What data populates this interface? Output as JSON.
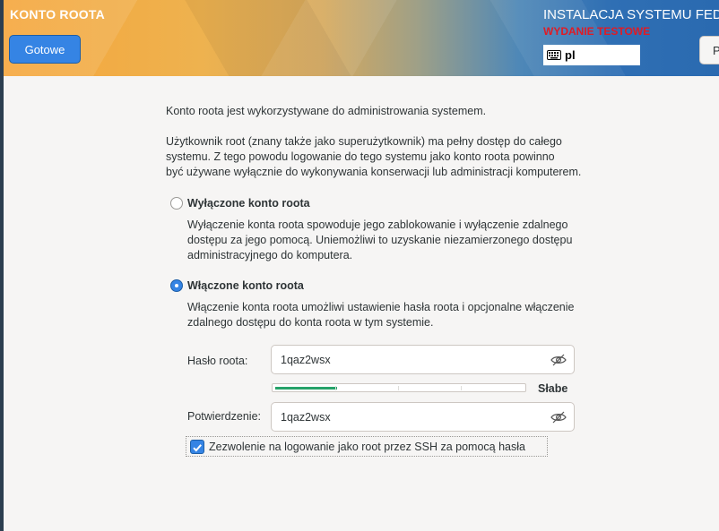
{
  "header": {
    "spoke_title": "KONTO ROOTA",
    "done_label": "Gotowe",
    "product_title": "INSTALACJA SYSTEMU FEDORA",
    "beta_warning": "WYDANIE TESTOWE",
    "keyboard_layout": "pl",
    "help_label": "P"
  },
  "content": {
    "intro": "Konto roota jest wykorzystywane do administrowania systemem.",
    "description_lines": [
      "Użytkownik root (znany także jako superużytkownik) ma pełny dostęp do całego",
      "systemu. Z tego powodu logowanie do tego systemu jako konto roota powinno",
      "być używane wyłącznie do wykonywania konserwacji lub administracji komputerem."
    ],
    "options": {
      "disable": {
        "label": "Wyłączone konto roota",
        "selected": false,
        "description_lines": [
          "Wyłączenie konta roota spowoduje jego zablokowanie i wyłączenie zdalnego",
          "dostępu za jego pomocą. Uniemożliwi to uzyskanie niezamierzonego dostępu",
          "administracyjnego do komputera."
        ]
      },
      "enable": {
        "label": "Włączone konto roota",
        "selected": true,
        "description_lines": [
          "Włączenie konta roota umożliwi ustawienie hasła roota i opcjonalne włączenie",
          "zdalnego dostępu do konta roota w tym systemie."
        ]
      }
    },
    "password": {
      "label": "Hasło roota:",
      "value": "1qaz2wsx",
      "strength_label": "Słabe",
      "strength_fraction": 0.25
    },
    "confirm": {
      "label": "Potwierdzenie:",
      "value": "1qaz2wsx"
    },
    "ssh": {
      "label": "Zezwolenie na logowanie jako root przez SSH za pomocą hasła",
      "checked": true
    }
  },
  "colors": {
    "accent": "#3584e4",
    "warning": "#e01b24",
    "strength_weak": "#26a269"
  }
}
